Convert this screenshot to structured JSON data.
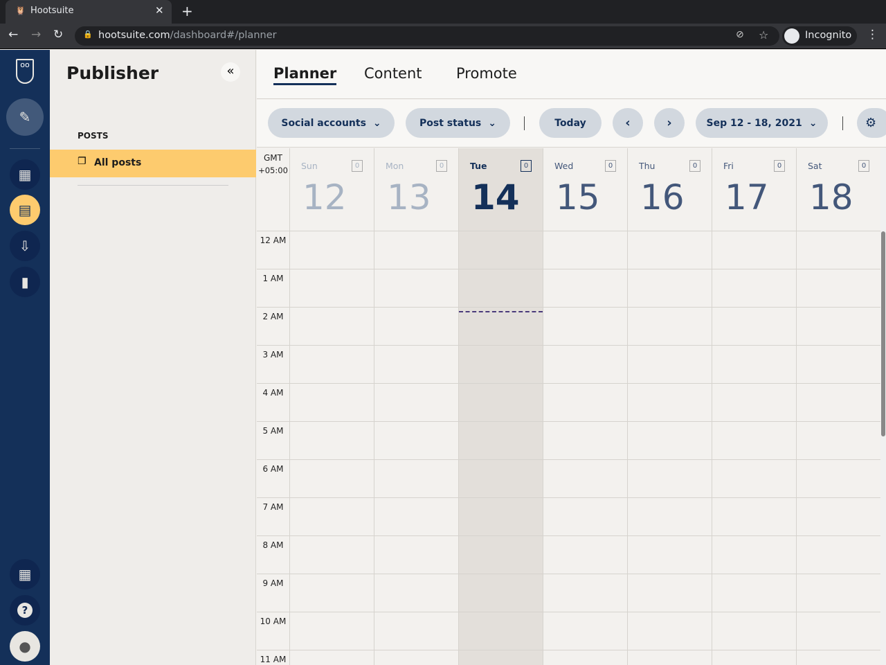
{
  "browser": {
    "tab_title": "Hootsuite",
    "url_host": "hootsuite.com",
    "url_path": "/dashboard#/planner",
    "profile": "Incognito"
  },
  "sidebar": {
    "title": "Publisher",
    "section": "POSTS",
    "items": [
      {
        "label": "All posts",
        "active": true
      }
    ]
  },
  "main": {
    "tabs": [
      {
        "label": "Planner",
        "active": true
      },
      {
        "label": "Content"
      },
      {
        "label": "Promote"
      }
    ],
    "toolbar": {
      "social_accounts": "Social accounts",
      "post_status": "Post status",
      "today": "Today",
      "date_range": "Sep 12 - 18, 2021"
    },
    "timezone": [
      "GMT",
      "+05:00"
    ],
    "days": [
      {
        "name": "Sun",
        "num": "12",
        "count": "0",
        "state": "past"
      },
      {
        "name": "Mon",
        "num": "13",
        "count": "0",
        "state": "past"
      },
      {
        "name": "Tue",
        "num": "14",
        "count": "0",
        "state": "today"
      },
      {
        "name": "Wed",
        "num": "15",
        "count": "0",
        "state": "future"
      },
      {
        "name": "Thu",
        "num": "16",
        "count": "0",
        "state": "future"
      },
      {
        "name": "Fri",
        "num": "17",
        "count": "0",
        "state": "future"
      },
      {
        "name": "Sat",
        "num": "18",
        "count": "0",
        "state": "future"
      }
    ],
    "hours": [
      "12 AM",
      "1 AM",
      "2 AM",
      "3 AM",
      "4 AM",
      "5 AM",
      "6 AM",
      "7 AM",
      "8 AM",
      "9 AM",
      "10 AM",
      "11 AM"
    ]
  },
  "colors": {
    "rail": "#143059",
    "accent": "#fdcb6e",
    "navy": "#143059"
  }
}
